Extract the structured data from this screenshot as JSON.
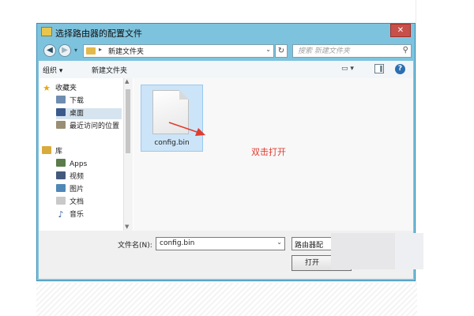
{
  "window": {
    "title": "选择路由器的配置文件",
    "close_label": "✕"
  },
  "address_bar": {
    "breadcrumb": "新建文件夹",
    "search_placeholder": "搜索 新建文件夹"
  },
  "toolbar": {
    "organize_label": "组织 ▾",
    "new_folder_label": "新建文件夹"
  },
  "nav": {
    "favorites": [
      {
        "label": "收藏夹",
        "icon": "star-icon"
      },
      {
        "label": "下载",
        "icon": "download-icon"
      },
      {
        "label": "桌面",
        "icon": "desktop-icon"
      },
      {
        "label": "最近访问的位置",
        "icon": "recent-places-icon"
      }
    ],
    "libraries": [
      {
        "label": "库",
        "icon": "library-icon"
      },
      {
        "label": "Apps",
        "icon": "apps-icon"
      },
      {
        "label": "视频",
        "icon": "video-icon"
      },
      {
        "label": "图片",
        "icon": "pictures-icon"
      },
      {
        "label": "文档",
        "icon": "documents-icon"
      },
      {
        "label": "音乐",
        "icon": "music-icon"
      }
    ]
  },
  "files": [
    {
      "name": "config.bin"
    }
  ],
  "annotation": {
    "text": "双击打开",
    "color": "#e13b2f"
  },
  "footer": {
    "filename_label": "文件名(N):",
    "filename_value": "config.bin",
    "file_type": "路由器配",
    "open_label": "打开"
  }
}
